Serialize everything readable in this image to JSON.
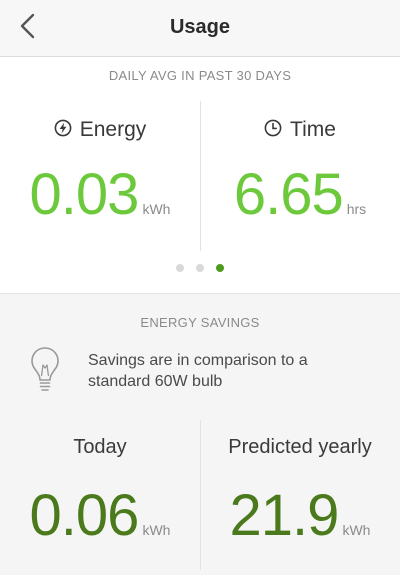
{
  "nav": {
    "title": "Usage",
    "back_icon": "chevron-left-icon"
  },
  "daily": {
    "header": "DAILY AVG IN PAST 30 DAYS",
    "energy": {
      "label": "Energy",
      "icon": "lightning-circle-icon",
      "value": "0.03",
      "unit": "kWh"
    },
    "time": {
      "label": "Time",
      "icon": "clock-icon",
      "value": "6.65",
      "unit": "hrs"
    },
    "pager": {
      "count": 3,
      "active_index": 2
    }
  },
  "savings": {
    "header": "ENERGY SAVINGS",
    "icon": "lightbulb-icon",
    "note_line1": "Savings are in comparison to a",
    "note_line2": "standard 60W bulb",
    "today": {
      "label": "Today",
      "value": "0.06",
      "unit": "kWh"
    },
    "yearly": {
      "label": "Predicted yearly",
      "value": "21.9",
      "unit": "kWh"
    }
  },
  "colors": {
    "bright_green": "#6cc93b",
    "dark_green": "#4a7a1b",
    "pager_active": "#4f9a1d",
    "pager_inactive": "#d9d9d9"
  }
}
